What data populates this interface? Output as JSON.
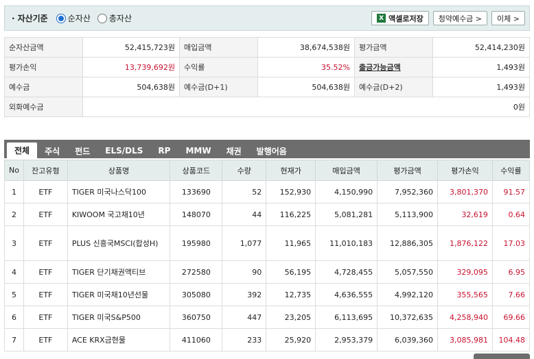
{
  "header": {
    "title": "자산기준",
    "radio_options": [
      {
        "label": "순자산",
        "selected": true
      },
      {
        "label": "총자산",
        "selected": false
      }
    ],
    "buttons": {
      "excel_label": "액셀로저장",
      "subscription_label": "청약예수금 >",
      "transfer_label": "이체 >"
    }
  },
  "summary": {
    "row1": {
      "l1": "순자산금액",
      "v1": "52,415,723원",
      "l2": "매입금액",
      "v2": "38,674,538원",
      "l3": "평가금액",
      "v3": "52,414,230원"
    },
    "row2": {
      "l1": "평가손익",
      "v1": "13,739,692원",
      "l2": "수익률",
      "v2": "35.52%",
      "l3": "출금가능금액",
      "v3": "1,493원"
    },
    "row3": {
      "l1": "예수금",
      "v1": "504,638원",
      "l2": "예수금(D+1)",
      "v2": "504,638원",
      "l3": "예수금(D+2)",
      "v3": "1,493원"
    },
    "row4": {
      "l1": "외화예수금",
      "v1": "0원"
    }
  },
  "tabs": [
    "전체",
    "주식",
    "펀드",
    "ELS/DLS",
    "RP",
    "MMW",
    "채권",
    "발행어음"
  ],
  "holdings": {
    "columns": [
      "No",
      "잔고유형",
      "상품명",
      "상품코드",
      "수량",
      "현재가",
      "매입금액",
      "평가금액",
      "평가손익",
      "수익률"
    ],
    "rows": [
      {
        "no": "1",
        "type": "ETF",
        "name": "TIGER 미국나스닥100",
        "code": "133690",
        "qty": "52",
        "price": "152,930",
        "buy": "4,150,990",
        "eval": "7,952,360",
        "pl": "3,801,370",
        "ret": "91.57"
      },
      {
        "no": "2",
        "type": "ETF",
        "name": "KIWOOM 국고채10년",
        "code": "148070",
        "qty": "44",
        "price": "116,225",
        "buy": "5,081,281",
        "eval": "5,113,900",
        "pl": "32,619",
        "ret": "0.64"
      },
      {
        "no": "3",
        "type": "ETF",
        "name": "PLUS 신흥국MSCI(합성H)",
        "code": "195980",
        "qty": "1,077",
        "price": "11,965",
        "buy": "11,010,183",
        "eval": "12,886,305",
        "pl": "1,876,122",
        "ret": "17.03"
      },
      {
        "no": "4",
        "type": "ETF",
        "name": "TIGER 단기채권액티브",
        "code": "272580",
        "qty": "90",
        "price": "56,195",
        "buy": "4,728,455",
        "eval": "5,057,550",
        "pl": "329,095",
        "ret": "6.95"
      },
      {
        "no": "5",
        "type": "ETF",
        "name": "TIGER 미국채10년선물",
        "code": "305080",
        "qty": "392",
        "price": "12,735",
        "buy": "4,636,555",
        "eval": "4,992,120",
        "pl": "355,565",
        "ret": "7.66"
      },
      {
        "no": "6",
        "type": "ETF",
        "name": "TIGER 미국S&P500",
        "code": "360750",
        "qty": "447",
        "price": "23,205",
        "buy": "6,113,695",
        "eval": "10,372,635",
        "pl": "4,258,940",
        "ret": "69.66"
      },
      {
        "no": "7",
        "type": "ETF",
        "name": "ACE KRX금현물",
        "code": "411060",
        "qty": "233",
        "price": "25,920",
        "buy": "2,953,379",
        "eval": "6,039,360",
        "pl": "3,085,981",
        "ret": "104.48"
      }
    ]
  },
  "colors": {
    "header_bg": "#e4eeee",
    "tab_bar": "#6d6d6d",
    "positive": "#c8102e",
    "radio_accent": "#1f6fd0"
  }
}
